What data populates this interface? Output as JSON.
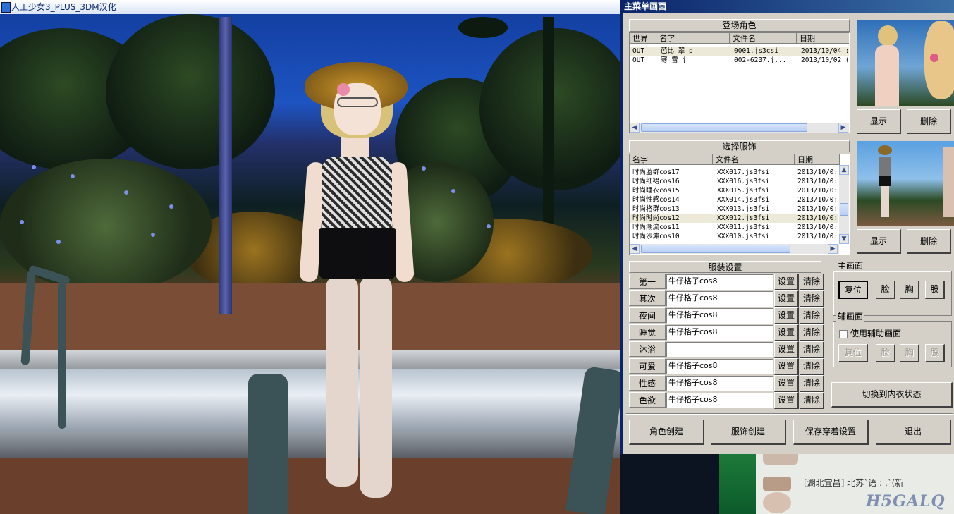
{
  "game_window": {
    "title": "人工少女3_PLUS_3DM汉化"
  },
  "main_menu": {
    "title": "主菜单画面",
    "characters": {
      "heading": "登场角色",
      "columns": [
        "世界",
        "名字",
        "文件名",
        "日期"
      ],
      "rows": [
        {
          "world": "OUT",
          "name": "芭比 翠 p",
          "file": "0001.js3csi",
          "date": "2013/10/04 :"
        },
        {
          "world": "OUT",
          "name": "寒 雪 j",
          "file": "002-6237.j...",
          "date": "2013/10/02 ("
        }
      ],
      "show_button": "显示",
      "delete_button": "删除"
    },
    "costumes": {
      "heading": "选择服饰",
      "columns": [
        "名字",
        "文件名",
        "日期"
      ],
      "rows": [
        {
          "name": "时尚蓝群cos17",
          "file": "XXX017.js3fsi",
          "date": "2013/10/0:"
        },
        {
          "name": "时尚红裙cos16",
          "file": "XXX016.js3fsi",
          "date": "2013/10/0:"
        },
        {
          "name": "时尚睡衣cos15",
          "file": "XXX015.js3fsi",
          "date": "2013/10/0:"
        },
        {
          "name": "时尚性感cos14",
          "file": "XXX014.js3fsi",
          "date": "2013/10/0:"
        },
        {
          "name": "时尚格群cos13",
          "file": "XXX013.js3fsi",
          "date": "2013/10/0:"
        },
        {
          "name": "时尚时尚cos12",
          "file": "XXX012.js3fsi",
          "date": "2013/10/0:"
        },
        {
          "name": "时尚潮流cos11",
          "file": "XXX011.js3fsi",
          "date": "2013/10/0:"
        },
        {
          "name": "时尚沙滩cos10",
          "file": "XXX010.js3fsi",
          "date": "2013/10/0:"
        }
      ],
      "show_button": "显示",
      "delete_button": "删除"
    },
    "outfit_settings": {
      "heading": "服装设置",
      "set_label": "设置",
      "clear_label": "清除",
      "slots": [
        {
          "label": "第一",
          "value": "牛仔格子cos8"
        },
        {
          "label": "其次",
          "value": "牛仔格子cos8"
        },
        {
          "label": "夜间",
          "value": "牛仔格子cos8"
        },
        {
          "label": "睡觉",
          "value": "牛仔格子cos8"
        },
        {
          "label": "沐浴",
          "value": ""
        },
        {
          "label": "可爱",
          "value": "牛仔格子cos8"
        },
        {
          "label": "性感",
          "value": "牛仔格子cos8"
        },
        {
          "label": "色欲",
          "value": "牛仔格子cos8"
        }
      ]
    },
    "main_view": {
      "legend": "主画面",
      "buttons": [
        "复位",
        "脸",
        "胸",
        "股"
      ]
    },
    "aux_view": {
      "legend": "辅画面",
      "checkbox_label": "使用辅助画面",
      "checked": false,
      "buttons": [
        "复位",
        "脸",
        "胸",
        "股"
      ]
    },
    "switch_button": "切换到内衣状态",
    "footer_buttons": [
      "角色创建",
      "服饰创建",
      "保存穿着设置",
      "退出"
    ]
  },
  "chat": {
    "message": "[湖北宜昌] 北苏`语   :  ,`(新"
  },
  "watermark": "H5GALQ",
  "colors": {
    "titlebar": "#0a246a",
    "face": "#d4d0c8",
    "selection": "#ece9d8"
  }
}
